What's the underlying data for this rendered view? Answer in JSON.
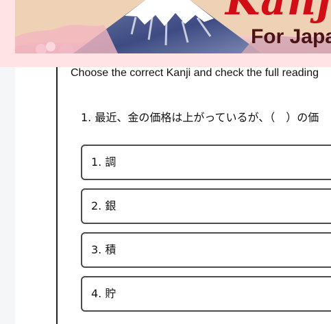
{
  "banner": {
    "title": "Kanji",
    "subtitle": "For Japa"
  },
  "instruction": "Choose the correct Kanji and check the full reading",
  "question": {
    "text": "1. 最近、金の価格は上がっているが、（　）の価"
  },
  "options": [
    {
      "label": "1. 調"
    },
    {
      "label": "2. 銀"
    },
    {
      "label": "3. 積"
    },
    {
      "label": "4. 貯"
    }
  ],
  "colors": {
    "banner_background": "#ffe3e5",
    "title_red": "#d10d16",
    "subtitle_brown": "#4a1212",
    "option_border": "#4a4a4a"
  }
}
